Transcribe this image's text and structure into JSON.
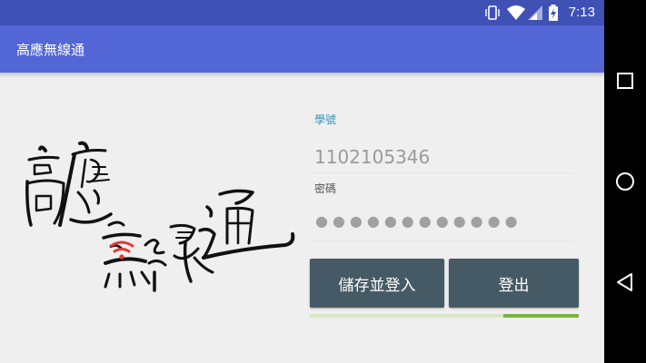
{
  "status_bar": {
    "time": "7:13",
    "icons": [
      "vibrate-icon",
      "wifi-icon",
      "signal-icon",
      "battery-charging-icon"
    ]
  },
  "app_bar": {
    "title": "高應無線通"
  },
  "logo": {
    "alt_text": "高應無線通",
    "accent_color": "#e53935"
  },
  "login_form": {
    "student_id_label": "學號",
    "student_id_value": "1102105346",
    "password_label": "密碼",
    "password_mask": "●●●●●●●●●●●●"
  },
  "buttons": {
    "save_and_login": "儲存並登入",
    "logout": "登出"
  },
  "progress": {
    "value": 0.28,
    "color": "#7cb342",
    "track_color": "#d9e7c7"
  },
  "nav_bar": {
    "icons": [
      "recents-icon",
      "home-icon",
      "back-icon"
    ]
  },
  "colors": {
    "status_bar": "#3f51b5",
    "app_bar": "#5366d6",
    "button": "#455a64",
    "label_accent": "#3b8fbf"
  }
}
